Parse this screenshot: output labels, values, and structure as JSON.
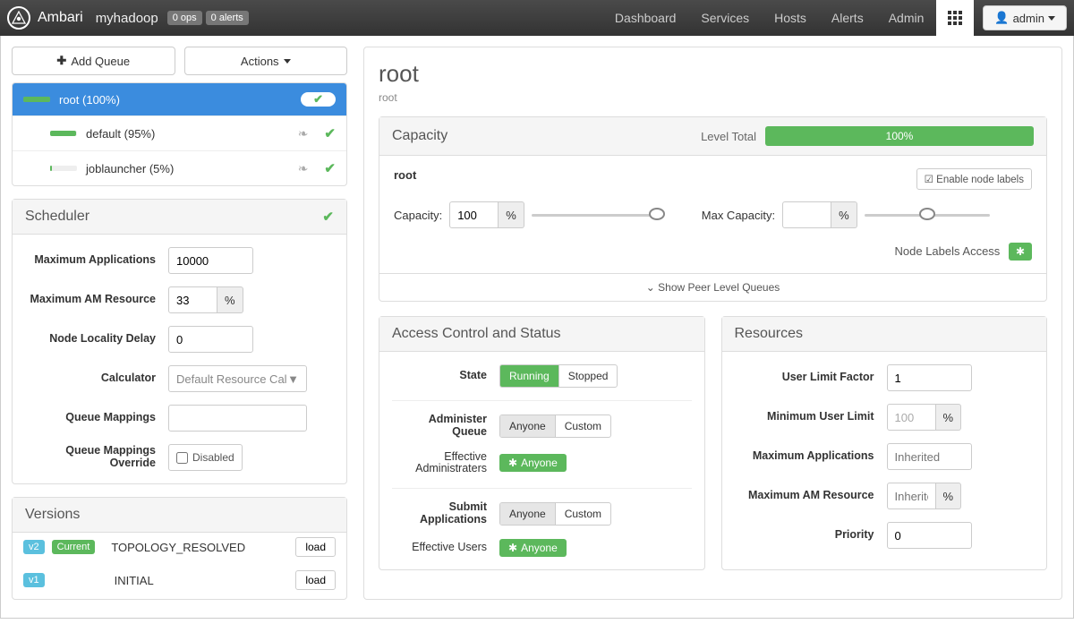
{
  "topbar": {
    "brand": "Ambari",
    "cluster": "myhadoop",
    "ops_badge": "0 ops",
    "alerts_badge": "0 alerts",
    "nav": [
      "Dashboard",
      "Services",
      "Hosts",
      "Alerts",
      "Admin"
    ],
    "user_label": "admin"
  },
  "left": {
    "add_queue": "Add Queue",
    "actions": "Actions",
    "tree": [
      {
        "name": "root (100%)",
        "fill": 100,
        "selected": true
      },
      {
        "name": "default (95%)",
        "fill": 95,
        "indent": true
      },
      {
        "name": "joblauncher (5%)",
        "fill": 5,
        "indent": true
      }
    ],
    "scheduler": {
      "title": "Scheduler",
      "max_apps": {
        "label": "Maximum Applications",
        "value": "10000"
      },
      "max_am": {
        "label": "Maximum AM Resource",
        "value": "33",
        "unit": "%"
      },
      "node_delay": {
        "label": "Node Locality Delay",
        "value": "0"
      },
      "calculator": {
        "label": "Calculator",
        "value": "Default Resource Cal"
      },
      "mappings": {
        "label": "Queue Mappings",
        "value": ""
      },
      "override": {
        "label": "Queue Mappings Override",
        "checkbox": "Disabled"
      }
    },
    "versions": {
      "title": "Versions",
      "rows": [
        {
          "tag": "v2",
          "current": "Current",
          "name": "TOPOLOGY_RESOLVED",
          "action": "load"
        },
        {
          "tag": "v1",
          "current": null,
          "name": "INITIAL",
          "action": "load"
        }
      ]
    }
  },
  "right": {
    "title": "root",
    "breadcrumb": "root",
    "capacity": {
      "title": "Capacity",
      "level_label": "Level Total",
      "level_value": "100%",
      "queue_name": "root",
      "enable_labels": "Enable node labels",
      "capacity_label": "Capacity:",
      "capacity_value": "100",
      "capacity_unit": "%",
      "max_capacity_label": "Max Capacity:",
      "max_capacity_value": "",
      "max_capacity_unit": "%",
      "node_labels_access": "Node Labels Access",
      "peer": "Show Peer Level Queues"
    },
    "acl": {
      "title": "Access Control and Status",
      "state_label": "State",
      "state_running": "Running",
      "state_stopped": "Stopped",
      "admin_queue_label": "Administer Queue",
      "anyone": "Anyone",
      "custom": "Custom",
      "eff_admin_label": "Effective Administraters",
      "anyone_chip": "Anyone",
      "submit_label": "Submit Applications",
      "eff_users_label": "Effective Users"
    },
    "resources": {
      "title": "Resources",
      "ulf": {
        "label": "User Limit Factor",
        "value": "1"
      },
      "mul": {
        "label": "Minimum User Limit",
        "value": "100",
        "unit": "%"
      },
      "max_apps": {
        "label": "Maximum Applications",
        "placeholder": "Inherited"
      },
      "max_am": {
        "label": "Maximum AM Resource",
        "placeholder": "Inherite",
        "unit": "%"
      },
      "priority": {
        "label": "Priority",
        "value": "0"
      }
    }
  }
}
